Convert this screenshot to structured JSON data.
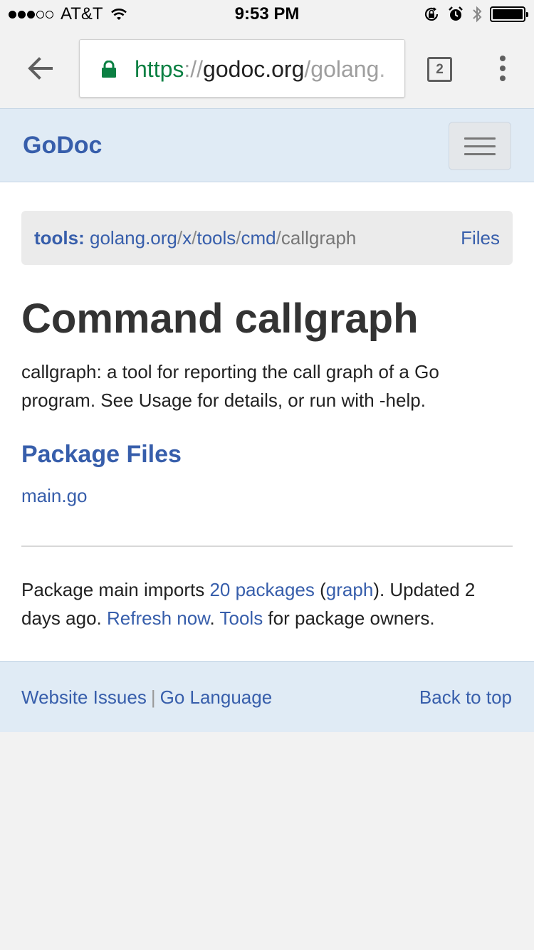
{
  "status_bar": {
    "carrier": "AT&T",
    "signal_bars_filled": 3,
    "signal_bars_total": 5,
    "time": "9:53 PM",
    "battery_level": 1.0,
    "icons": [
      "wifi-icon",
      "rotation-lock-icon",
      "alarm-icon",
      "bluetooth-icon",
      "battery-icon"
    ]
  },
  "browser": {
    "url_scheme": "https",
    "url_separator": "://",
    "url_host": "godoc.org",
    "url_path": "/golang.",
    "tab_count": "2",
    "icons": [
      "back-arrow-icon",
      "lock-icon",
      "overflow-menu-icon"
    ]
  },
  "navbar": {
    "brand": "GoDoc",
    "icons": [
      "hamburger-icon"
    ]
  },
  "breadcrumb": {
    "root": "tools:",
    "parts": [
      "golang.org",
      "x",
      "tools",
      "cmd"
    ],
    "separator": "/",
    "current": "callgraph",
    "files_link": "Files"
  },
  "page": {
    "title": "Command callgraph",
    "description": "callgraph: a tool for reporting the call graph of a Go program. See Usage for details, or run with -help.",
    "package_files_heading": "Package Files",
    "files": [
      "main.go"
    ]
  },
  "meta": {
    "text_1": "Package main imports ",
    "imports_link": "20 packages",
    "text_2": " (",
    "graph_link": "graph",
    "text_3": "). Updated 2 days ago. ",
    "refresh_link": "Refresh now",
    "text_4": ". ",
    "tools_link": "Tools",
    "text_5": " for package owners."
  },
  "footer": {
    "website_issues": "Website Issues",
    "separator": "|",
    "go_language": "Go Language",
    "back_to_top": "Back to top"
  },
  "colors": {
    "link": "#375eab",
    "navbar_bg": "#e0ebf5",
    "url_scheme": "#0b8043",
    "breadcrumb_bg": "#ebebeb"
  }
}
